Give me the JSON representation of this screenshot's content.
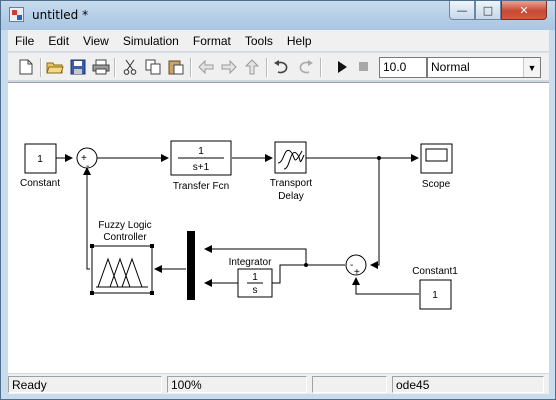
{
  "window": {
    "title": "untitled *"
  },
  "menu": [
    "File",
    "Edit",
    "View",
    "Simulation",
    "Format",
    "Tools",
    "Help"
  ],
  "toolbar": {
    "stop_time": "10.0",
    "sim_mode": "Normal",
    "icons": [
      "new-icon",
      "open-icon",
      "save-icon",
      "print-icon",
      "cut-icon",
      "copy-icon",
      "paste-icon",
      "back-icon",
      "forward-icon",
      "up-icon",
      "undo-icon",
      "redo-icon",
      "play-icon",
      "stop-icon"
    ]
  },
  "blocks": {
    "constant": {
      "value": "1",
      "label": "Constant"
    },
    "transfer_fcn": {
      "num": "1",
      "den": "s+1",
      "label": "Transfer Fcn"
    },
    "transport_delay": {
      "label_line1": "Transport",
      "label_line2": "Delay"
    },
    "scope": {
      "label": "Scope"
    },
    "fuzzy": {
      "label_line1": "Fuzzy Logic",
      "label_line2": "Controller"
    },
    "integrator": {
      "num": "1",
      "den": "s",
      "label": "Integrator"
    },
    "constant1": {
      "value": "1",
      "label": "Constant1"
    },
    "sum1_signs": {
      "a": "+",
      "b": "-"
    },
    "sum2_signs": {
      "a": "-",
      "b": "+"
    }
  },
  "status": {
    "state": "Ready",
    "zoom": "100%",
    "solver": "ode45"
  }
}
